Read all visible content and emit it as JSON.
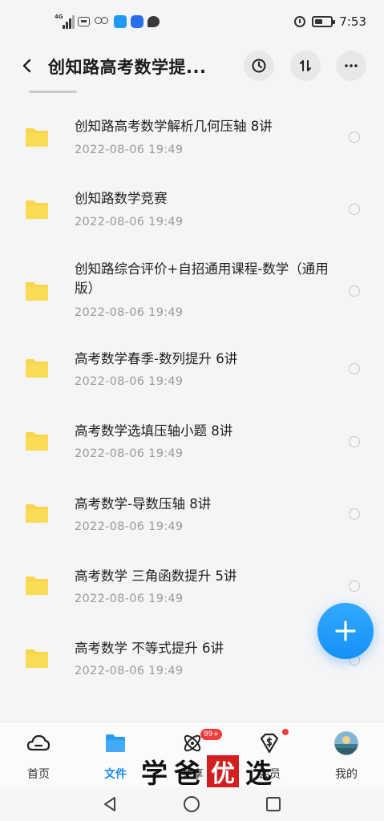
{
  "status_bar": {
    "network": "4G",
    "time": "7:53"
  },
  "header": {
    "title": "创知路高考数学提..."
  },
  "files": [
    {
      "name": "创知路高考数学解析几何压轴  8讲",
      "date": "2022-08-06  19:49",
      "icon": "folder-icon"
    },
    {
      "name": "创知路数学竞赛",
      "date": "2022-08-06  19:49",
      "icon": "folder-icon"
    },
    {
      "name": "创知路综合评价+自招通用课程-数学（通用版）",
      "date": "2022-08-06  19:49",
      "icon": "folder-icon"
    },
    {
      "name": "高考数学春季-数列提升 6讲",
      "date": "2022-08-06  19:49",
      "icon": "folder-icon"
    },
    {
      "name": "高考数学选填压轴小题   8讲",
      "date": "2022-08-06  19:49",
      "icon": "folder-icon"
    },
    {
      "name": "高考数学-导数压轴  8讲",
      "date": "2022-08-06  19:49",
      "icon": "folder-icon"
    },
    {
      "name": "高考数学 三角函数提升 5讲",
      "date": "2022-08-06  19:49",
      "icon": "folder-icon"
    },
    {
      "name": "高考数学  不等式提升 6讲",
      "date": "2022-08-06  19:49",
      "icon": "folder-icon"
    }
  ],
  "tabs": [
    {
      "label": "首页",
      "icon": "home-cloud-icon",
      "active": false
    },
    {
      "label": "文件",
      "icon": "file-folder-icon",
      "active": true
    },
    {
      "label": "共享",
      "icon": "share-atom-icon",
      "active": false,
      "badge": "99+"
    },
    {
      "label": "会员",
      "icon": "vip-diamond-icon",
      "active": false,
      "dot": true
    },
    {
      "label": "我的",
      "icon": "avatar",
      "active": false
    }
  ],
  "watermark": {
    "chars": [
      "学",
      "爸",
      "优",
      "选"
    ]
  },
  "colors": {
    "accent": "#1a8cf2",
    "folder": "#f9d54a",
    "badge": "#f23c3c",
    "watermark_box": "#d11f1f"
  }
}
